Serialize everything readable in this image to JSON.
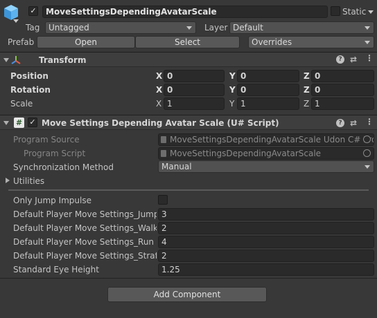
{
  "gameobject": {
    "active_checked": "✓",
    "name": "MoveSettingsDependingAvatarScale",
    "static_label": "Static",
    "tag_label": "Tag",
    "tag_value": "Untagged",
    "layer_label": "Layer",
    "layer_value": "Default",
    "prefab_label": "Prefab",
    "open_label": "Open",
    "select_label": "Select",
    "overrides_label": "Overrides"
  },
  "transform": {
    "title": "Transform",
    "position_label": "Position",
    "rotation_label": "Rotation",
    "scale_label": "Scale",
    "axis_x": "X",
    "axis_y": "Y",
    "axis_z": "Z",
    "position": {
      "x": "0",
      "y": "0",
      "z": "0"
    },
    "rotation": {
      "x": "0",
      "y": "0",
      "z": "0"
    },
    "scale": {
      "x": "1",
      "y": "1",
      "z": "1"
    }
  },
  "script_component": {
    "icon_glyph": "#",
    "enabled_checked": "✓",
    "title": "Move Settings Depending Avatar Scale (U# Script)",
    "program_source_label": "Program Source",
    "program_source_value": "MoveSettingsDependingAvatarScale Udon C# Pro",
    "program_script_label": "Program Script",
    "program_script_value": "MoveSettingsDependingAvatarScale",
    "sync_method_label": "Synchronization Method",
    "sync_method_value": "Manual",
    "utilities_label": "Utilities",
    "only_jump_label": "Only Jump Impulse",
    "jump_label": "Default Player Move Settings_Jump I",
    "jump_value": "3",
    "walk_label": "Default Player Move Settings_Walk S",
    "walk_value": "2",
    "run_label": "Default Player Move Settings_Run Sp",
    "run_value": "4",
    "strafe_label": "Default Player Move Settings_Strafe",
    "strafe_value": "2",
    "eye_label": "Standard Eye Height",
    "eye_value": "1.25"
  },
  "add_component_label": "Add Component",
  "colors": {
    "background": "#383838",
    "field": "#2a2a2a",
    "header": "#3e3e3e",
    "accent_blue": "#5aa9e6"
  }
}
